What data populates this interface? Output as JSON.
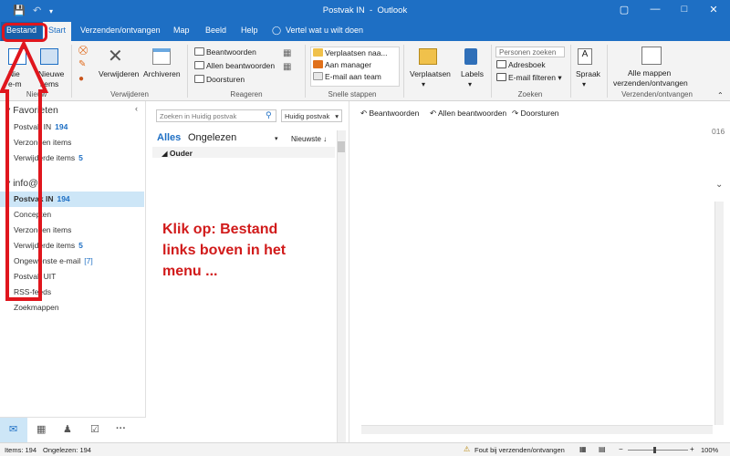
{
  "window": {
    "title": "Postvak IN",
    "app": "Outlook"
  },
  "menu": {
    "file": "Bestand",
    "tabs": [
      "Start",
      "Verzenden/ontvangen",
      "Map",
      "Beeld",
      "Help"
    ],
    "tell_me": "Vertel wat u wilt doen"
  },
  "ribbon": {
    "new_label_1": "Nie",
    "new_label_2": "e-m",
    "new_items": "Nieuwe",
    "new_items_2": "items",
    "group_new": "Nieuw",
    "delete": "Verwijderen",
    "archive": "Archiveren",
    "group_delete": "Verwijderen",
    "reply": "Beantwoorden",
    "reply_all": "Allen beantwoorden",
    "forward": "Doorsturen",
    "group_respond": "Reageren",
    "quick_steps": [
      "Verplaatsen naa...",
      "Aan manager",
      "E-mail aan team"
    ],
    "group_quick": "Snelle stappen",
    "move": "Verplaatsen",
    "labels": "Labels",
    "search_people": "Personen zoeken",
    "address_book": "Adresboek",
    "email_filter": "E-mail filteren",
    "group_find": "Zoeken",
    "speech": "Spraak",
    "send_all_1": "Alle mappen",
    "send_all_2": "verzenden/ontvangen",
    "group_send": "Verzenden/ontvangen"
  },
  "sidebar": {
    "favorites": "Favorieten",
    "fav_items": [
      {
        "label": "Postvak IN",
        "count": "194"
      },
      {
        "label": "Verzonden items",
        "count": ""
      },
      {
        "label": "Verwijderde items",
        "count": "5"
      }
    ],
    "account": "info@",
    "acct_items": [
      {
        "label": "Postvak IN",
        "count": "194"
      },
      {
        "label": "Concepten",
        "count": ""
      },
      {
        "label": "Verzonden items",
        "count": ""
      },
      {
        "label": "Verwijderde items",
        "count": "5"
      },
      {
        "label": "Ongewenste e-mail",
        "count": "[7]"
      },
      {
        "label": "Postvak UIT",
        "count": ""
      },
      {
        "label": "RSS-feeds",
        "count": ""
      },
      {
        "label": "Zoekmappen",
        "count": ""
      }
    ]
  },
  "maillist": {
    "search_placeholder": "Zoeken in Huidig postvak",
    "scope": "Huidig postvak",
    "filter_all": "Alles",
    "filter_unread": "Ongelezen",
    "sort": "Nieuwste",
    "group": "Ouder"
  },
  "reading": {
    "reply": "Beantwoorden",
    "reply_all": "Allen beantwoorden",
    "forward": "Doorsturen",
    "year_fragment": "016"
  },
  "annotation": {
    "line1": "Klik op: Bestand",
    "line2": "links boven in het",
    "line3": "menu ..."
  },
  "status": {
    "items": "Items: 194",
    "unread": "Ongelezen: 194",
    "error": "Fout bij verzenden/ontvangen",
    "zoom": "100%"
  },
  "colors": {
    "accent": "#1e6fc4",
    "annotation": "#d11a1a"
  }
}
